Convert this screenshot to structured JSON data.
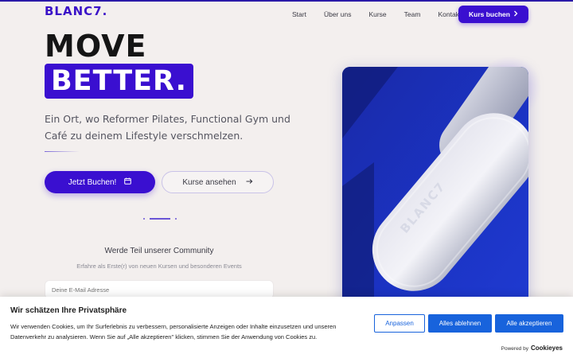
{
  "brand": {
    "logo": "BLANC7."
  },
  "nav": {
    "items": [
      "Start",
      "Über uns",
      "Kurse",
      "Team",
      "Kontakt"
    ],
    "cta_label": "Kurs buchen"
  },
  "hero": {
    "title_line1": "MOVE",
    "title_line2": "BETTER.",
    "lead": "Ein Ort, wo Reformer Pilates, Functional Gym und Café zu deinem Lifestyle verschmelzen.",
    "primary_label": "Jetzt Buchen!",
    "secondary_label": "Kurse ansehen",
    "image_text": "BLANC7",
    "accent_color": "#3a0fd0"
  },
  "community": {
    "title": "Werde Teil unserer Community",
    "subtitle": "Erfahre als Erste(r) von neuen Kursen und besonderen Events",
    "email_placeholder": "Deine E-Mail Adresse"
  },
  "cookie": {
    "title": "Wir schätzen Ihre Privatsphäre",
    "text": "Wir verwenden Cookies, um Ihr Surferlebnis zu verbessern, personalisierte Anzeigen oder Inhalte einzusetzen und unseren Datenverkehr zu analysieren. Wenn Sie auf „Alle akzeptieren\" klicken, stimmen Sie der Anwendung von Cookies zu.",
    "customize_label": "Anpassen",
    "reject_label": "Alles ablehnen",
    "accept_label": "Alle akzeptieren",
    "powered_by": "Powered by",
    "powered_brand": "Cookieyes",
    "button_color": "#1863dc"
  }
}
